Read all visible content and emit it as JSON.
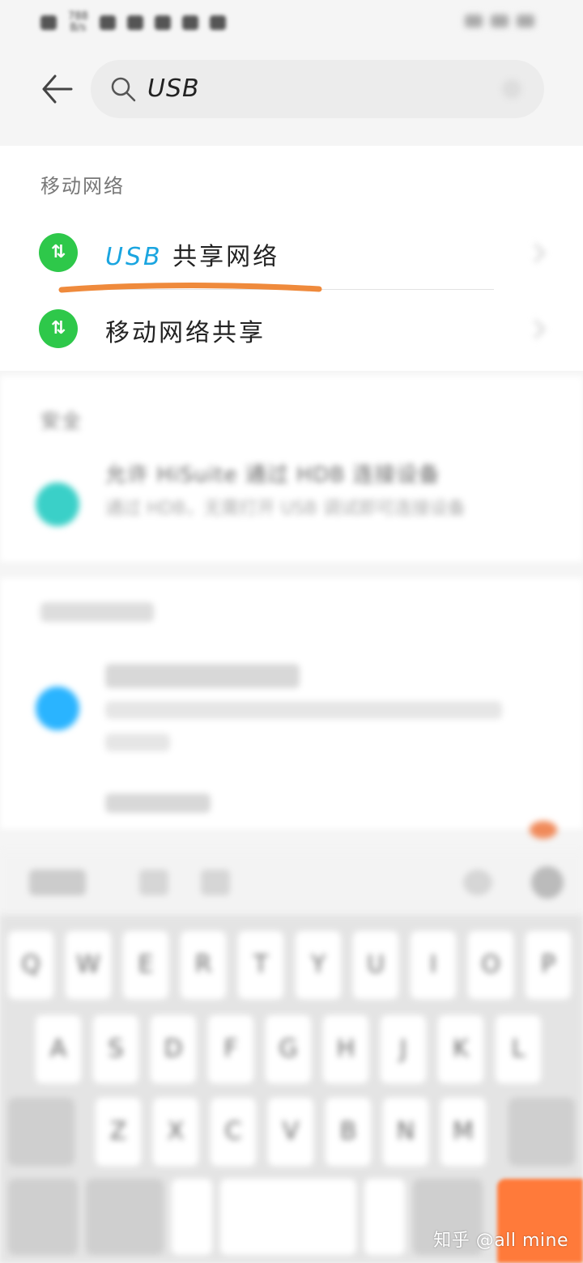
{
  "status_bar": {
    "speed_value": "788",
    "speed_unit": "B/s"
  },
  "search": {
    "query": "USB"
  },
  "sections": {
    "mobile_network": {
      "title": "移动网络",
      "items": [
        {
          "highlight": "USB",
          "label": " 共享网络",
          "icon": "transfer-arrows-icon"
        },
        {
          "highlight": "",
          "label": "移动网络共享",
          "icon": "transfer-arrows-icon"
        }
      ]
    },
    "security": {
      "title": "安全",
      "item_title": "允许 HiSuite 通过 HDB 连接设备",
      "item_sub": "通过 HDB，无需打开 USB 调试即可连接设备"
    }
  },
  "keyboard": {
    "row1": [
      "Q",
      "W",
      "E",
      "R",
      "T",
      "Y",
      "U",
      "I",
      "O",
      "P"
    ],
    "row2": [
      "A",
      "S",
      "D",
      "F",
      "G",
      "H",
      "J",
      "K",
      "L"
    ],
    "row3": [
      "Z",
      "X",
      "C",
      "V",
      "B",
      "N",
      "M"
    ]
  },
  "watermark": "知乎 @all mine",
  "colors": {
    "accent": "#1aa5e0",
    "icon_green": "#2ec84a",
    "enter_key": "#ff7a3a",
    "underline": "#ef8a3c"
  }
}
